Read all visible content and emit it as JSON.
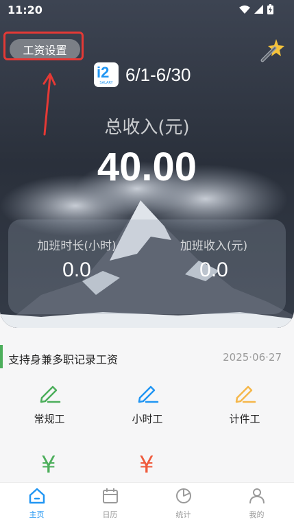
{
  "status_bar": {
    "time": "11:20"
  },
  "header": {
    "salary_settings_label": "工资设置",
    "date_range": "6/1-6/30"
  },
  "summary": {
    "income_label": "总收入(元)",
    "income_value": "40.00"
  },
  "overtime": {
    "hours_label": "加班时长(小时)",
    "hours_value": "0.0",
    "income_label": "加班收入(元)",
    "income_value": "0.0"
  },
  "section": {
    "title": "支持身兼多职记录工资",
    "date": "2025·06·27"
  },
  "work_types": [
    {
      "label": "常规工",
      "color": "#4cae5b"
    },
    {
      "label": "小时工",
      "color": "#2196f3"
    },
    {
      "label": "计件工",
      "color": "#f5b74a"
    }
  ],
  "yen_icons": [
    {
      "symbol": "¥",
      "color": "#4cae5b"
    },
    {
      "symbol": "¥",
      "color": "#ef5a3c"
    }
  ],
  "tabs": [
    {
      "label": "主页",
      "icon": "home-icon",
      "active": true
    },
    {
      "label": "日历",
      "icon": "calendar-icon",
      "active": false
    },
    {
      "label": "统计",
      "icon": "pie-chart-icon",
      "active": false
    },
    {
      "label": "我的",
      "icon": "profile-icon",
      "active": false
    }
  ],
  "colors": {
    "accent": "#2196f3",
    "highlight": "#e53935",
    "green": "#4cae5b"
  }
}
